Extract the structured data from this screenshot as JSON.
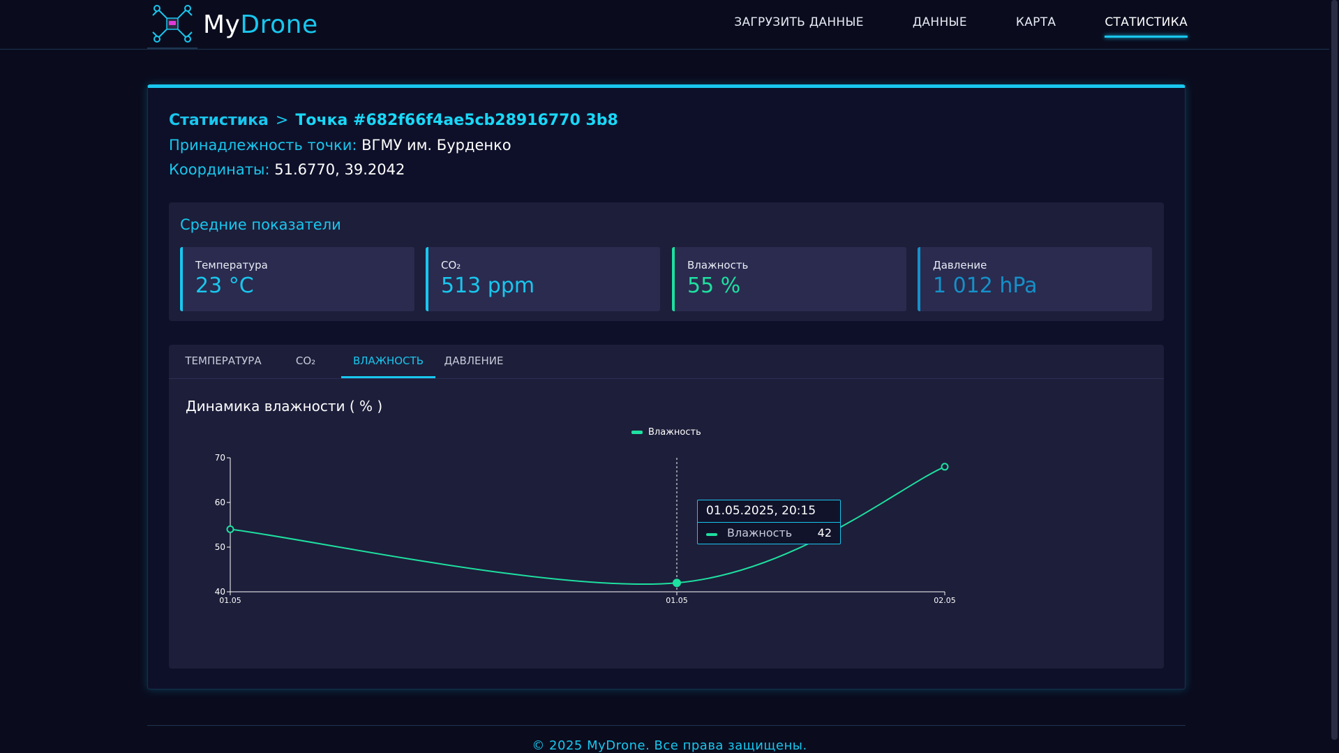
{
  "header": {
    "logo_my": "My",
    "logo_drone": "Drone",
    "nav": [
      {
        "label": "ЗАГРУЗИТЬ ДАННЫЕ",
        "active": false
      },
      {
        "label": "ДАННЫЕ",
        "active": false
      },
      {
        "label": "КАРТА",
        "active": false
      },
      {
        "label": "СТАТИСТИКА",
        "active": true
      }
    ]
  },
  "breadcrumb": {
    "root": "Статистика",
    "separator": ">",
    "current": "Точка #682f66f4ae5cb28916770 3b8"
  },
  "point": {
    "owner_label": "Принадлежность точки:",
    "owner_value": "ВГМУ им. Бурденко",
    "coords_label": "Координаты:",
    "coords_value": "51.6770, 39.2042"
  },
  "averages": {
    "title": "Средние показатели",
    "metrics": [
      {
        "label": "Температура",
        "value": "23 °C",
        "color": "#19c7ee"
      },
      {
        "label": "CO₂",
        "value": "513 ppm",
        "color": "#19c7ee"
      },
      {
        "label": "Влажность",
        "value": "55 %",
        "color": "#1ee0a0"
      },
      {
        "label": "Давление",
        "value": "1 012 hPa",
        "color": "#1590c8"
      }
    ]
  },
  "tabs": [
    {
      "label": "ТЕМПЕРАТУРА",
      "active": false
    },
    {
      "label": "CO₂",
      "active": false
    },
    {
      "label": "ВЛАЖНОСТЬ",
      "active": true
    },
    {
      "label": "ДАВЛЕНИЕ",
      "active": false
    }
  ],
  "chart_data": {
    "type": "line",
    "title": "Динамика влажности ( % )",
    "x": [
      "01.05",
      "01.05",
      "02.05"
    ],
    "series": [
      {
        "name": "Влажность",
        "values": [
          54,
          42,
          68
        ],
        "color": "#1ee0a0"
      }
    ],
    "yticks": [
      40,
      50,
      60,
      70
    ],
    "ylim": [
      40,
      70
    ],
    "legend_position": "top-center",
    "grid": false
  },
  "tooltip": {
    "date": "01.05.2025, 20:15",
    "series_name": "Влажность",
    "value": "42"
  },
  "footer": {
    "text": "© 2025 MyDrone. Все права защищены."
  }
}
